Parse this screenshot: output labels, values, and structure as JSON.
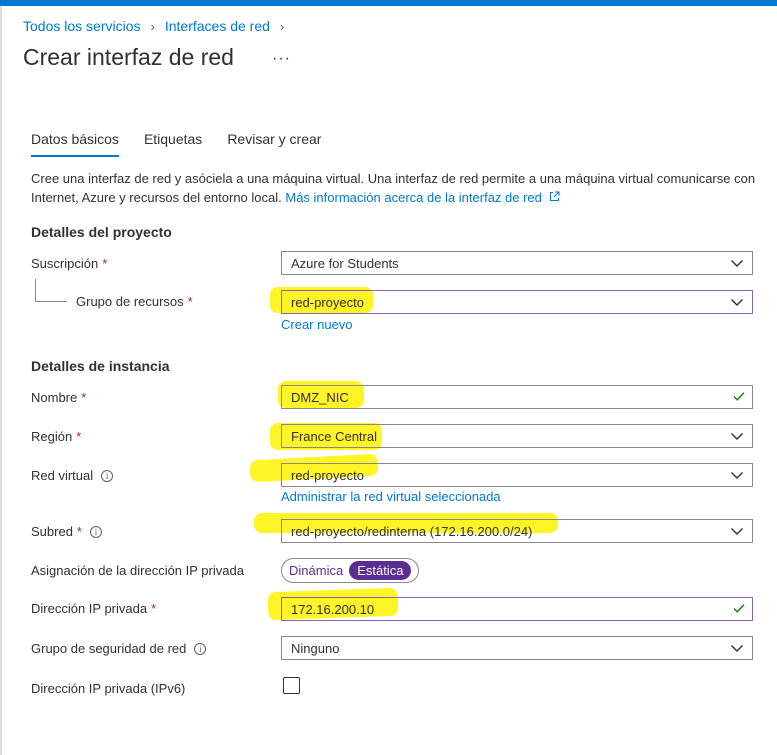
{
  "breadcrumb": {
    "item1": "Todos los servicios",
    "item2": "Interfaces de red",
    "sep": "›"
  },
  "page": {
    "title": "Crear interfaz de red",
    "more": "···"
  },
  "tabs": [
    {
      "label": "Datos básicos"
    },
    {
      "label": "Etiquetas"
    },
    {
      "label": "Revisar y crear"
    }
  ],
  "description": {
    "text": "Cree una interfaz de red y asóciela a una máquina virtual. Una interfaz de red permite a una máquina virtual comunicarse con Internet, Azure y recursos del entorno local.",
    "link": "Más información acerca de la interfaz de red"
  },
  "sections": {
    "project": "Detalles del proyecto",
    "instance": "Detalles de instancia"
  },
  "required_mark": "*",
  "info_mark": "i",
  "fields": {
    "subscription": {
      "label": "Suscripción",
      "value": "Azure for Students"
    },
    "resource_group": {
      "label": "Grupo de recursos",
      "value": "red-proyecto",
      "create_link": "Crear nuevo"
    },
    "name": {
      "label": "Nombre",
      "value": "DMZ_NIC"
    },
    "region": {
      "label": "Región",
      "value": "France Central"
    },
    "vnet": {
      "label": "Red virtual",
      "value": "red-proyecto",
      "manage_link": "Administrar la red virtual seleccionada"
    },
    "subnet": {
      "label": "Subred",
      "value": "red-proyecto/redinterna (172.16.200.0/24)"
    },
    "ip_assignment": {
      "label": "Asignación de la dirección IP privada",
      "options": [
        "Dinámica",
        "Estática"
      ],
      "selected": "Estática"
    },
    "private_ip": {
      "label": "Dirección IP privada",
      "value": "172.16.200.10"
    },
    "nsg": {
      "label": "Grupo de seguridad de red",
      "value": "Ninguno"
    },
    "ipv6": {
      "label": "Dirección IP privada (IPv6)",
      "checked": false
    }
  },
  "colors": {
    "accent": "#0078d4",
    "required": "#a4262c",
    "toggle_selected": "#5c2d91",
    "valid_check": "#107c10",
    "highlight": "#fff200"
  }
}
